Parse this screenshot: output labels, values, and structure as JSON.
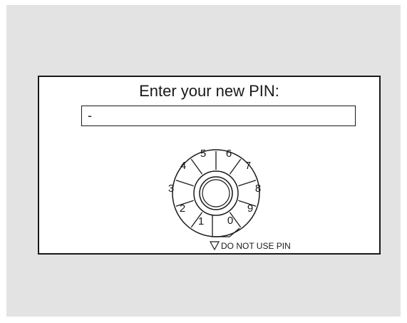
{
  "dialog": {
    "title": "Enter your new PIN:",
    "pin_value": "-"
  },
  "dial": {
    "digits": [
      "5",
      "6",
      "7",
      "8",
      "9",
      "0",
      "1",
      "2",
      "3",
      "4"
    ],
    "do_not_use_label": "DO NOT USE PIN"
  },
  "colors": {
    "background": "#e3e3e3",
    "dialog_bg": "#ffffff",
    "ink": "#1a1a1a"
  }
}
